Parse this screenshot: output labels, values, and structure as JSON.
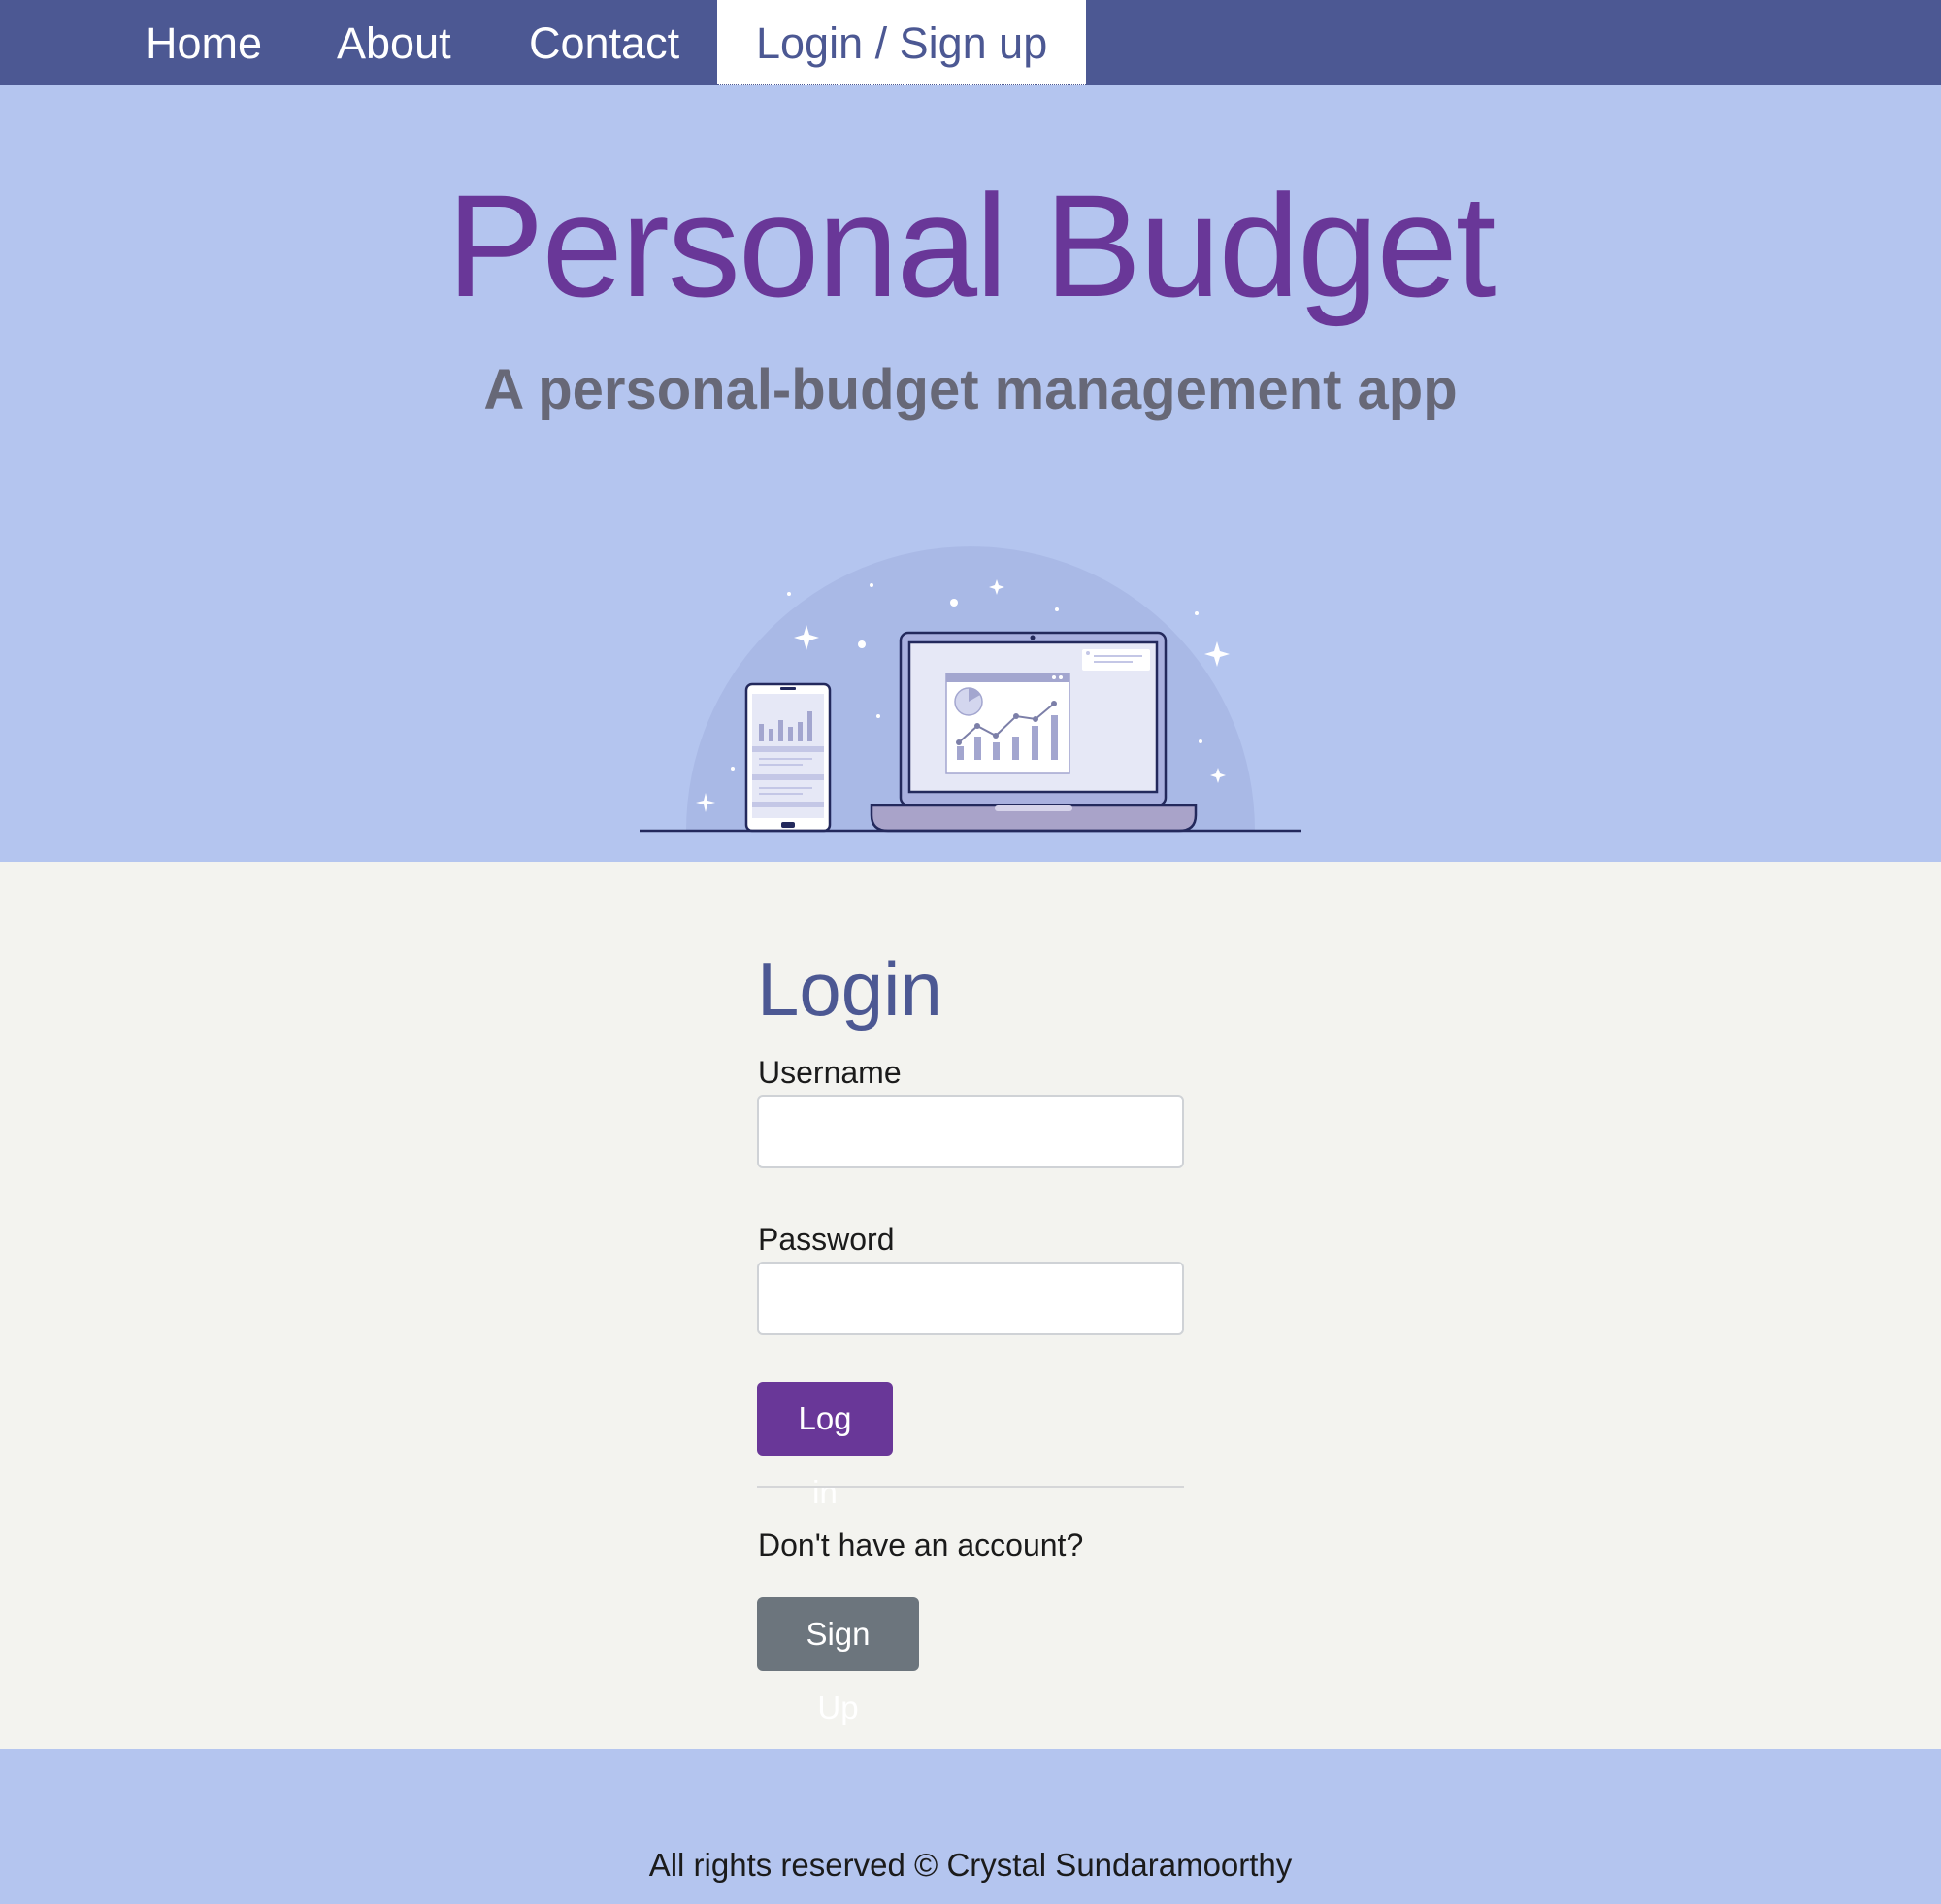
{
  "nav": {
    "items": [
      {
        "label": "Home"
      },
      {
        "label": "About"
      },
      {
        "label": "Contact"
      },
      {
        "label": "Login / Sign up",
        "active": true
      }
    ]
  },
  "hero": {
    "title": "Personal Budget",
    "subtitle": "A personal-budget management app",
    "illustration_icon": "devices-analytics-illustration"
  },
  "login": {
    "title": "Login",
    "username_label": "Username",
    "username_value": "",
    "password_label": "Password",
    "password_value": "",
    "login_button": "Log in",
    "no_account_text": "Don't have an account?",
    "signup_button": "Sign Up"
  },
  "footer": {
    "text": "All rights reserved © Crystal Sundaramoorthy"
  },
  "colors": {
    "nav_bg": "#4c5893",
    "hero_bg": "#b4c5ef",
    "title_purple": "#693798",
    "login_button": "#693798",
    "signup_button": "#6c757d",
    "page_bg": "#f3f3ef"
  }
}
